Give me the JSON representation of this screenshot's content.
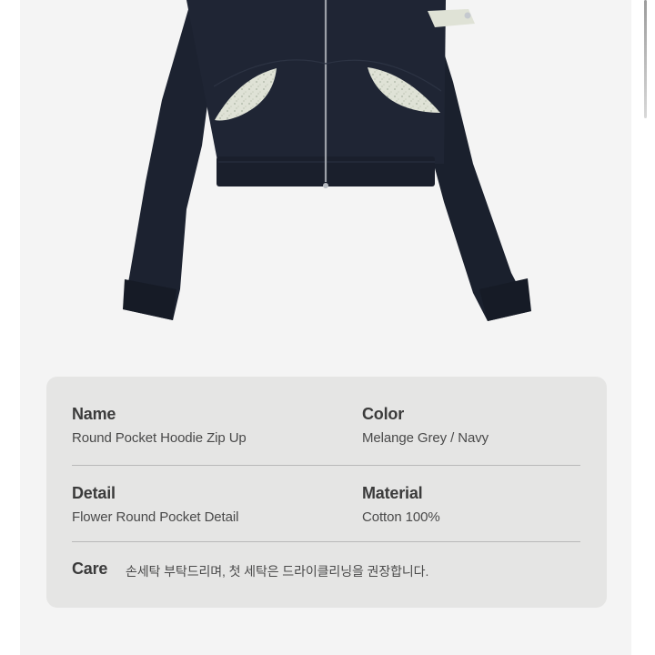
{
  "product": {
    "name_label": "Name",
    "name_value": "Round Pocket Hoodie Zip Up",
    "color_label": "Color",
    "color_value": "Melange Grey / Navy",
    "detail_label": "Detail",
    "detail_value": "Flower Round Pocket Detail",
    "material_label": "Material",
    "material_value": "Cotton 100%",
    "care_label": "Care",
    "care_value": "손세탁 부탁드리며, 첫 세탁은 드라이클리닝을 권장합니다."
  },
  "colors": {
    "page_background": "#f4f4f4",
    "card_background": "#e5e5e4",
    "hoodie_navy": "#1c2230",
    "pocket_lining": "#dcdfd4"
  },
  "icons": {
    "product_photo": "hoodie-illustration"
  }
}
